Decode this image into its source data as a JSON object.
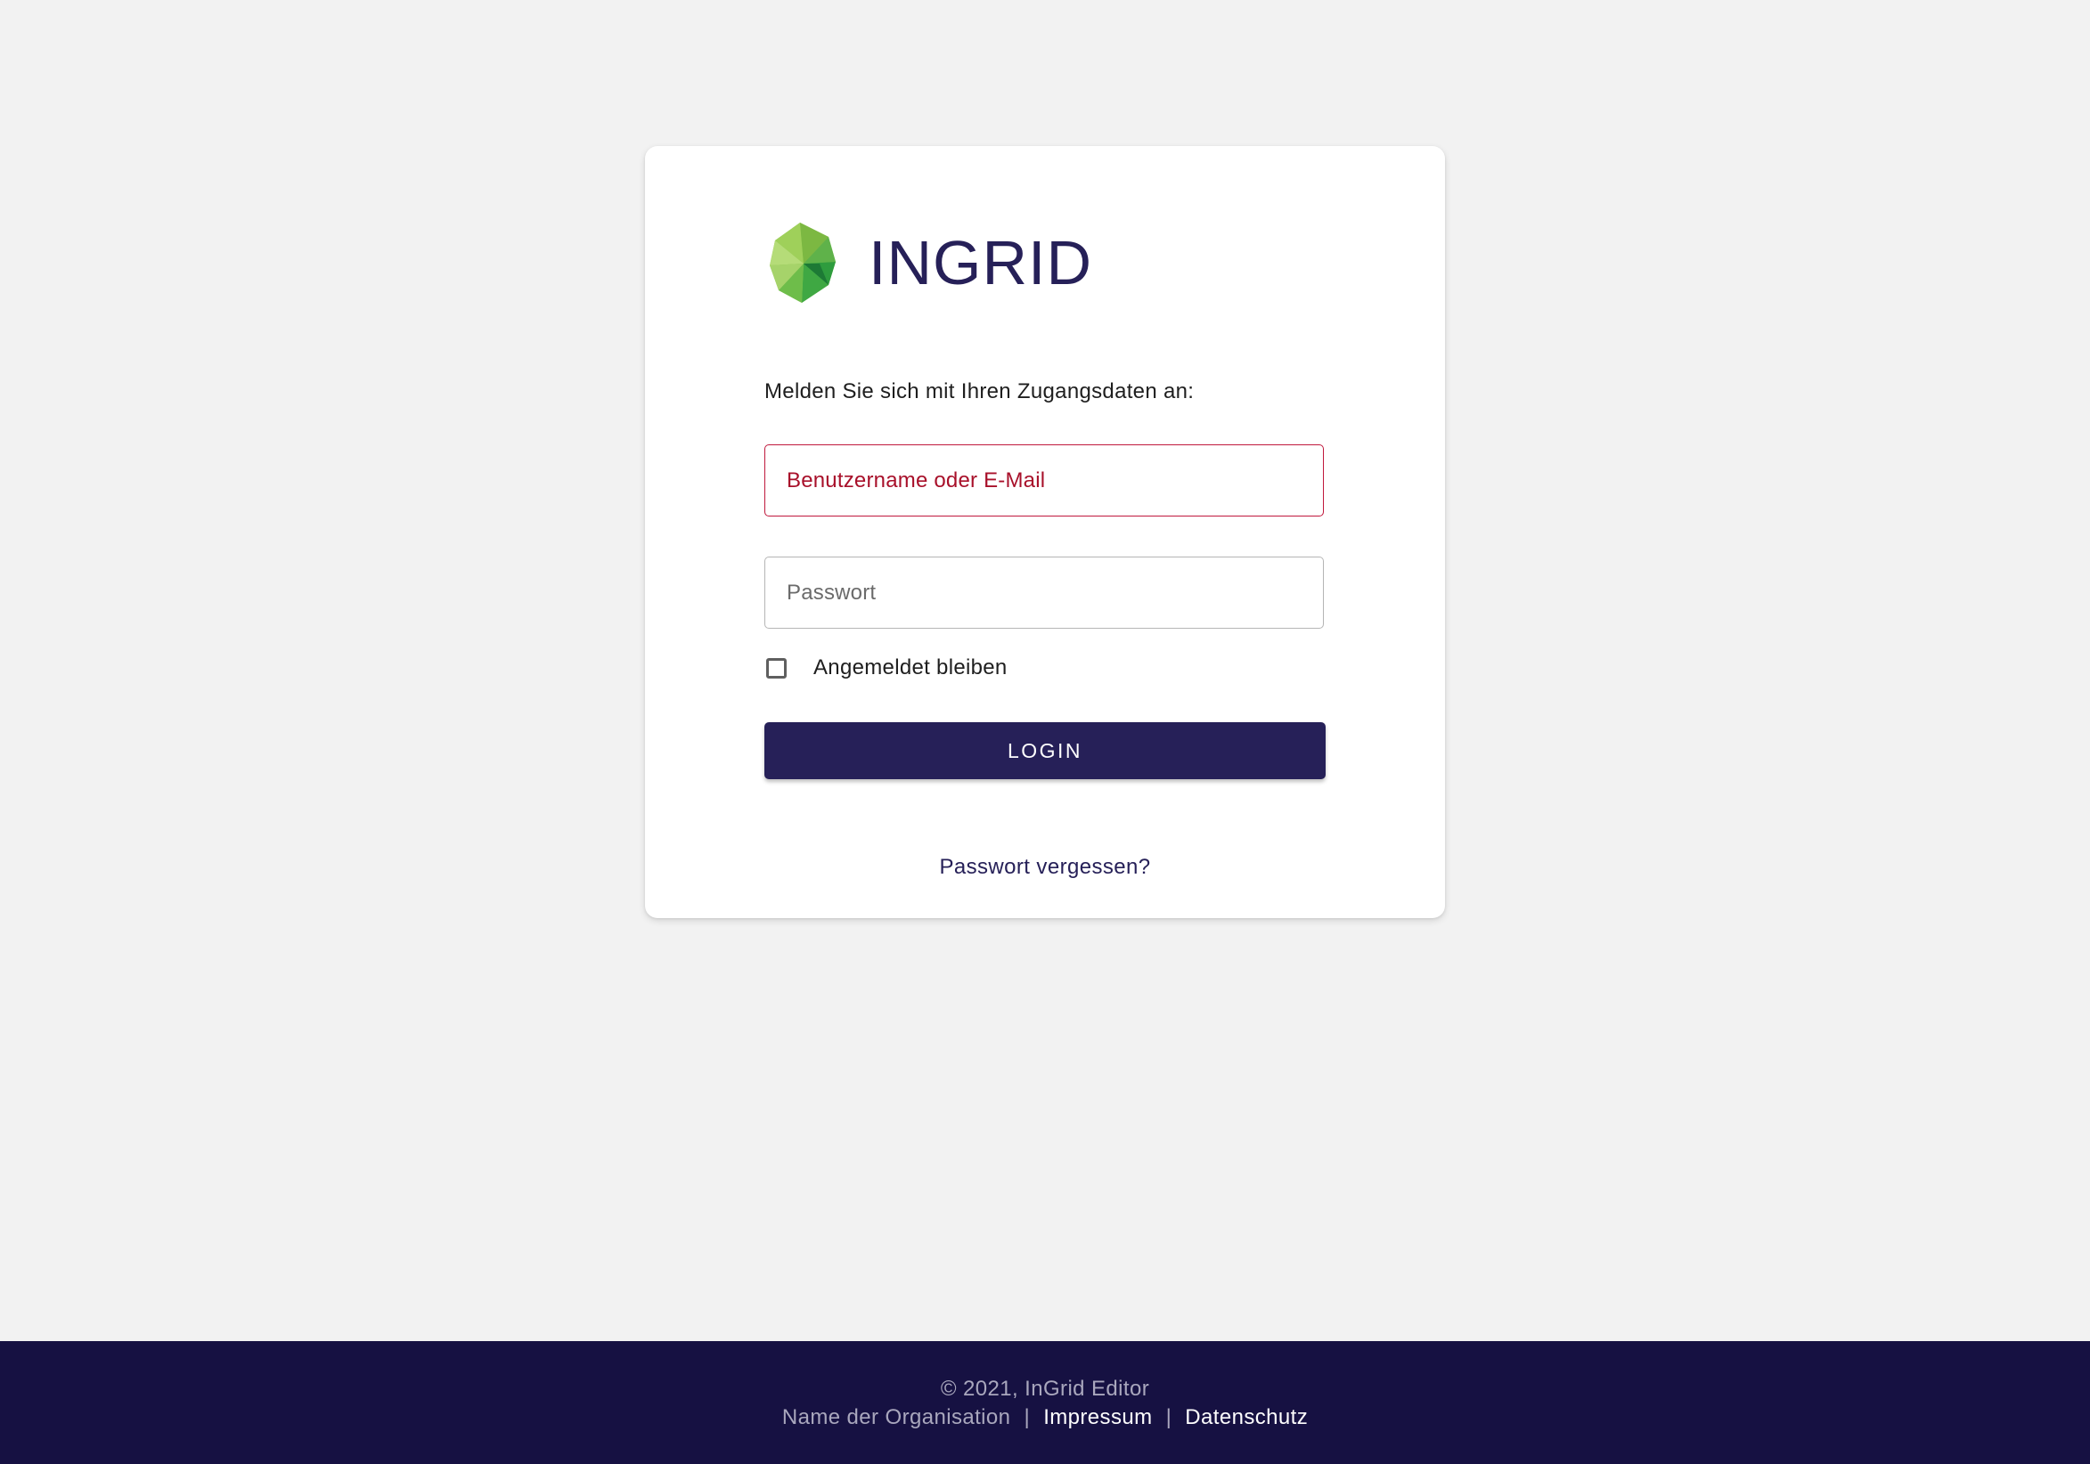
{
  "app": {
    "logo_text": "INGRID",
    "brand_color": "#262058",
    "logo_icon": "green-polygon-logo-icon"
  },
  "login": {
    "intro_text": "Melden Sie sich mit Ihren Zugangsdaten an:",
    "username": {
      "value": "",
      "placeholder": "Benutzername oder E-Mail",
      "state": "error",
      "error_color": "#c0183c"
    },
    "password": {
      "value": "",
      "placeholder": "Passwort"
    },
    "remember_me": {
      "label": "Angemeldet bleiben",
      "checked": false
    },
    "submit_label": "LOGIN",
    "forgot_password_label": "Passwort vergessen?"
  },
  "footer": {
    "copyright": "© 2021, InGrid Editor",
    "organization": "Name der Organisation",
    "separator_1": "|",
    "separator_2": "|",
    "links": [
      {
        "label": "Impressum"
      },
      {
        "label": "Datenschutz"
      }
    ],
    "background_color": "#161142"
  }
}
